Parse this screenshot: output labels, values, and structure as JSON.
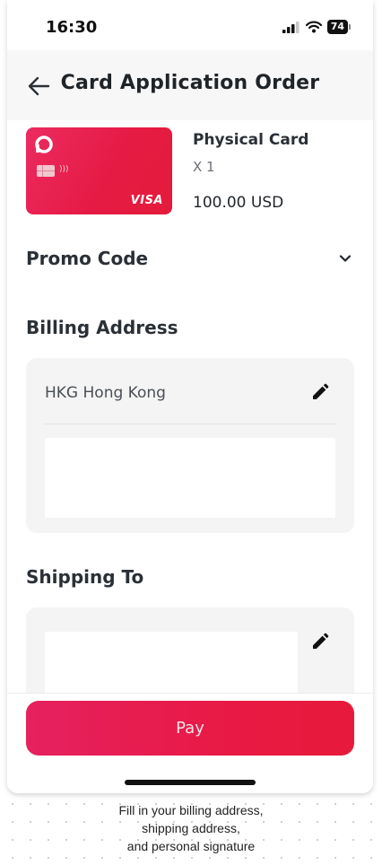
{
  "status_bar": {
    "time": "16:30",
    "battery": "74"
  },
  "header": {
    "title": "Card Application Order"
  },
  "product": {
    "name": "Physical Card",
    "quantity": "X 1",
    "price": "100.00 USD",
    "card_brand": "VISA"
  },
  "promo": {
    "label": "Promo Code"
  },
  "billing": {
    "title": "Billing Address",
    "address": "HKG Hong Kong"
  },
  "shipping": {
    "title": "Shipping To"
  },
  "footer": {
    "pay_label": "Pay"
  },
  "caption": {
    "line1": "Fill in your billing address,",
    "line2": "shipping address,",
    "line3": "and personal signature"
  },
  "colors": {
    "accent": "#e81a47",
    "card_gradient_start": "#ec2b60",
    "panel_bg": "#f4f4f4"
  },
  "icons": {
    "back": "arrow-left-icon",
    "chevron": "chevron-down-icon",
    "edit": "pencil-icon",
    "signal": "cellular-signal-icon",
    "wifi": "wifi-icon",
    "battery": "battery-icon"
  }
}
